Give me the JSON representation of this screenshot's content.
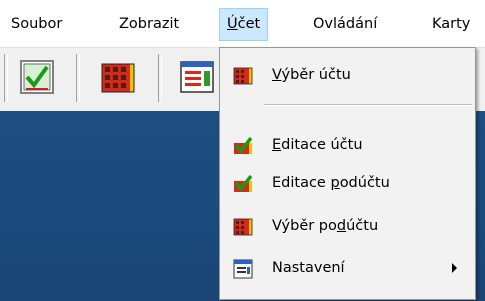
{
  "menubar": {
    "items": [
      {
        "pre": "Soubor",
        "ul": "",
        "post": ""
      },
      {
        "pre": "Zobrazit",
        "ul": "",
        "post": ""
      },
      {
        "pre": "",
        "ul": "Ú",
        "post": "čet"
      },
      {
        "pre": "Ovládání",
        "ul": "",
        "post": ""
      },
      {
        "pre": "Karty",
        "ul": "",
        "post": ""
      }
    ]
  },
  "toolbar": {
    "buttons": [
      {
        "icon": "green-check-window-icon"
      },
      {
        "icon": "red-grid-icon"
      },
      {
        "icon": "window-list-icon"
      }
    ]
  },
  "dropdown": {
    "items": [
      {
        "pre": "",
        "ul": "V",
        "post": "ýběr účtu",
        "icon": "red-grid-icon"
      },
      {
        "pre": "",
        "ul": "E",
        "post": "ditace účtu",
        "icon": "edit-check-icon"
      },
      {
        "pre": "Editace ",
        "ul": "p",
        "post": "odúčtu",
        "icon": "edit-check-icon"
      },
      {
        "pre": "Výběr po",
        "ul": "d",
        "post": "účtu",
        "icon": "red-grid-icon"
      },
      {
        "pre": "Nastavení",
        "ul": "",
        "post": "",
        "icon": "settings-window-icon"
      }
    ]
  }
}
